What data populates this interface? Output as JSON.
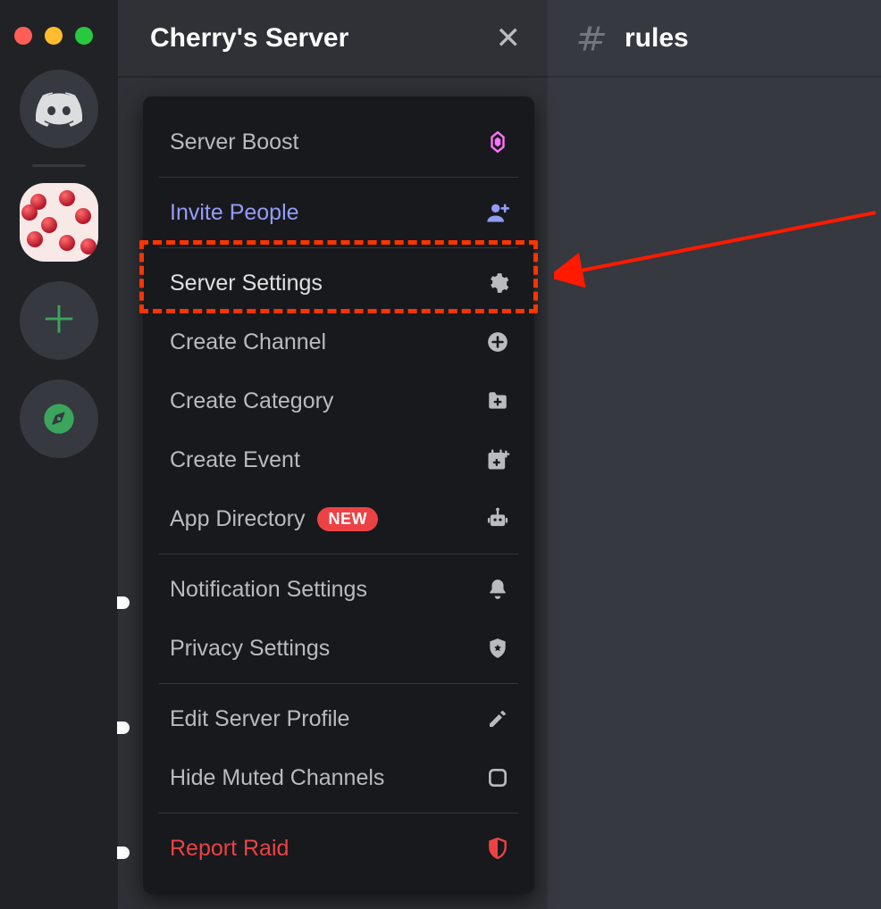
{
  "window": {
    "traffic_lights": [
      "close",
      "minimize",
      "zoom"
    ]
  },
  "server_rail": {
    "home_tooltip": "Home",
    "server_name": "Cherry's Server",
    "add_server_symbol": "＋",
    "explore_tooltip": "Explore Public Servers"
  },
  "server_header": {
    "title": "Cherry's Server",
    "close_symbol": "✕"
  },
  "chat_header": {
    "channel_name": "rules"
  },
  "menu": {
    "boost": {
      "label": "Server Boost"
    },
    "invite": {
      "label": "Invite People"
    },
    "settings": {
      "label": "Server Settings"
    },
    "create_channel": {
      "label": "Create Channel"
    },
    "create_category": {
      "label": "Create Category"
    },
    "create_event": {
      "label": "Create Event"
    },
    "app_directory": {
      "label": "App Directory",
      "badge": "NEW"
    },
    "notifications": {
      "label": "Notification Settings"
    },
    "privacy": {
      "label": "Privacy Settings"
    },
    "edit_profile": {
      "label": "Edit Server Profile"
    },
    "hide_muted": {
      "label": "Hide Muted Channels"
    },
    "report_raid": {
      "label": "Report Raid"
    }
  },
  "annotation": {
    "target": "Server Settings"
  }
}
